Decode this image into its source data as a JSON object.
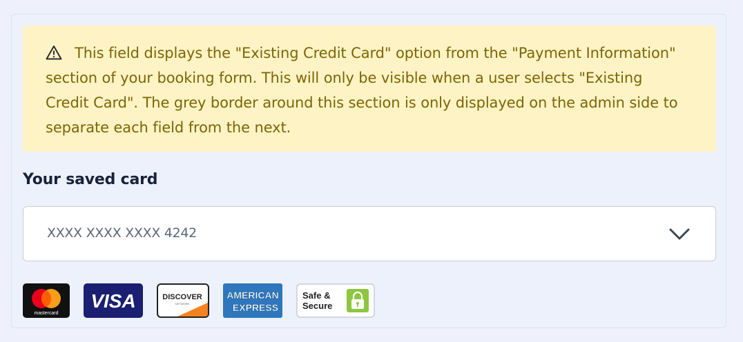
{
  "notice": {
    "icon": "warning-icon",
    "text": "This field displays the \"Existing Credit Card\" option from the \"Payment Information\" section of your booking form. This will only be visible when a user selects \"Existing Credit Card\". The grey border around this section is only displayed on the admin side to separate each field from the next.",
    "colors": {
      "background": "#fdf3c5",
      "text": "#7d6605"
    }
  },
  "saved_card": {
    "label": "Your saved card",
    "selected_value": "XXXX XXXX XXXX 4242",
    "dropdown_icon": "chevron-down-icon"
  },
  "payment_logos": {
    "mastercard": {
      "text": "mastercard"
    },
    "visa": {
      "text": "VISA"
    },
    "discover": {
      "text": "DISCOVER",
      "subtext": "NETWORK"
    },
    "amex": {
      "line1": "AMERICAN",
      "line2": "EXPRESS"
    },
    "safe_secure": {
      "line1": "Safe &",
      "line2": "Secure",
      "icon": "lock-icon"
    }
  }
}
